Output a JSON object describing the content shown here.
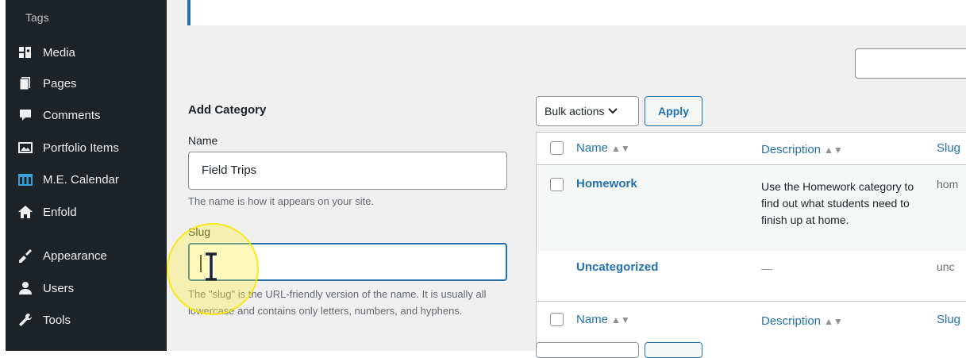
{
  "sidebar": {
    "partial_item": "Tags",
    "items": [
      {
        "label": "Media",
        "icon": "media-icon"
      },
      {
        "label": "Pages",
        "icon": "pages-icon"
      },
      {
        "label": "Comments",
        "icon": "comments-icon"
      },
      {
        "label": "Portfolio Items",
        "icon": "portfolio-icon"
      },
      {
        "label": "M.E. Calendar",
        "icon": "calendar-icon"
      },
      {
        "label": "Enfold",
        "icon": "home-icon"
      },
      {
        "label": "Appearance",
        "icon": "appearance-icon"
      },
      {
        "label": "Users",
        "icon": "users-icon"
      },
      {
        "label": "Tools",
        "icon": "tools-icon"
      }
    ]
  },
  "form": {
    "title": "Add Category",
    "name_label": "Name",
    "name_value": "Field Trips",
    "name_help": "The name is how it appears on your site.",
    "slug_label": "Slug",
    "slug_value": "",
    "slug_help": "The \"slug\" is the URL-friendly version of the name. It is usually all lowercase and contains only letters, numbers, and hyphens."
  },
  "toolbar": {
    "bulk_label": "Bulk actions",
    "apply_label": "Apply"
  },
  "table": {
    "headers": {
      "name": "Name",
      "description": "Description",
      "slug": "Slug"
    },
    "rows": [
      {
        "name": "Homework",
        "description": "Use the Homework category to find out what students need to finish up at home.",
        "slug": "hom"
      },
      {
        "name": "Uncategorized",
        "description": "—",
        "slug": "unc"
      }
    ]
  },
  "colors": {
    "accent": "#2271b1",
    "sidebar_bg": "#1d2327",
    "content_bg": "#f0f0f1",
    "highlight": "#fde92d"
  }
}
